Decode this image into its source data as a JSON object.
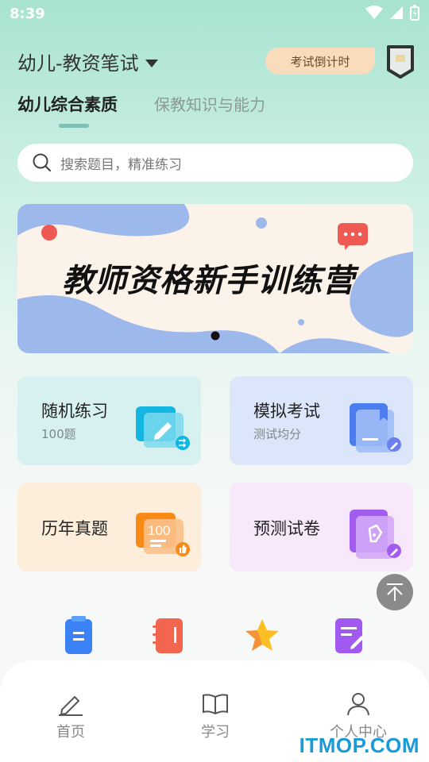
{
  "status_bar": {
    "time": "8:39"
  },
  "header": {
    "exam_selector": "幼儿-教资笔试",
    "countdown_label": "考试倒计时"
  },
  "tabs": [
    {
      "label": "幼儿综合素质",
      "active": true
    },
    {
      "label": "保教知识与能力",
      "active": false
    }
  ],
  "search": {
    "placeholder": "搜索题目，精准练习"
  },
  "banner": {
    "title": "教师资格新手训练营"
  },
  "cards": [
    {
      "label": "随机练习",
      "sub": "100题"
    },
    {
      "label": "模拟考试",
      "sub": "测试均分"
    },
    {
      "label": "历年真题",
      "sub": "",
      "icon_text": "100"
    },
    {
      "label": "预测试卷",
      "sub": ""
    }
  ],
  "bottom_nav": [
    {
      "label": "首页"
    },
    {
      "label": "学习"
    },
    {
      "label": "个人中心"
    }
  ],
  "watermark": "ITMOP.COM",
  "colors": {
    "accent": "#7fc0b4",
    "countdown_bg": "#f8dcbc",
    "watermark": "#1a9bd8"
  }
}
